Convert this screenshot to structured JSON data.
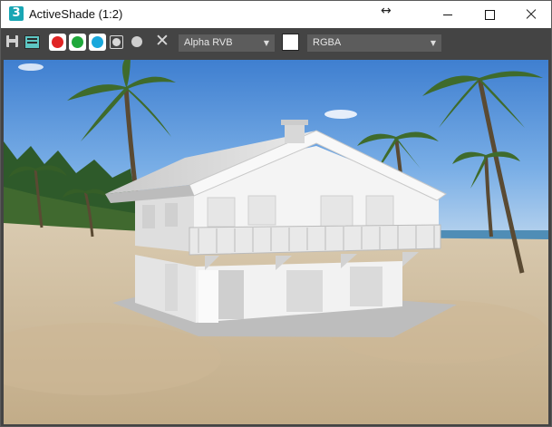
{
  "window": {
    "title": "ActiveShade (1:2)",
    "app_icon_text": "3",
    "resize_arrow": "↔"
  },
  "toolbar": {
    "display_channel": "Alpha RVB",
    "color_channels": "RGBA",
    "dropdown_arrow": "▼",
    "clear_icon": "✕",
    "background_swatch_color": "#ffffff"
  },
  "colors": {
    "red_channel": "#e02424",
    "green_channel": "#1fa83a",
    "blue_channel": "#19a8dc",
    "app_icon": "#18a6b4",
    "toolbar_bg": "#444444"
  },
  "viewport": {
    "content": "render-image"
  }
}
